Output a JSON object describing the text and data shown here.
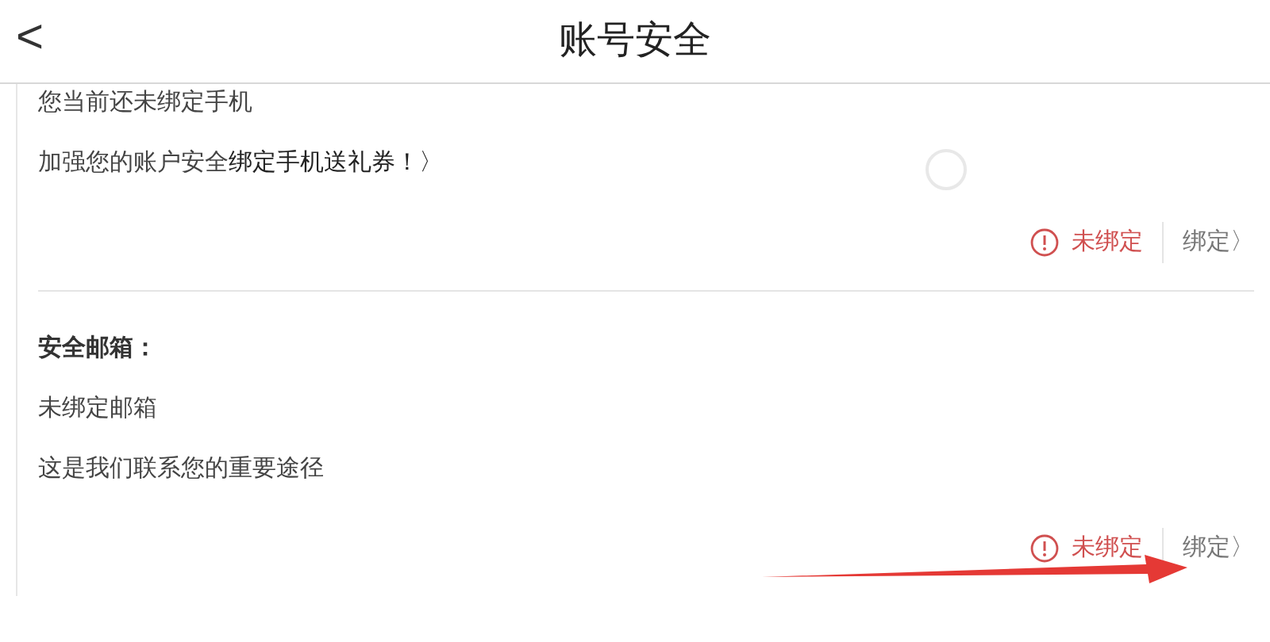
{
  "header": {
    "back": "<",
    "title": "账号安全"
  },
  "sections": [
    {
      "lines": [
        {
          "text": "您当前还未绑定手机"
        },
        {
          "text": "加强您的账户安全",
          "link": "绑定手机送礼券！〉"
        }
      ],
      "status": {
        "text": "未绑定",
        "bound": false
      },
      "action": "绑定〉",
      "loading": true
    },
    {
      "title": "安全邮箱：",
      "lines": [
        {
          "text": "未绑定邮箱"
        },
        {
          "text": "这是我们联系您的重要途径"
        }
      ],
      "status": {
        "text": "未绑定",
        "bound": false
      },
      "action": "绑定〉",
      "loading": false
    }
  ]
}
